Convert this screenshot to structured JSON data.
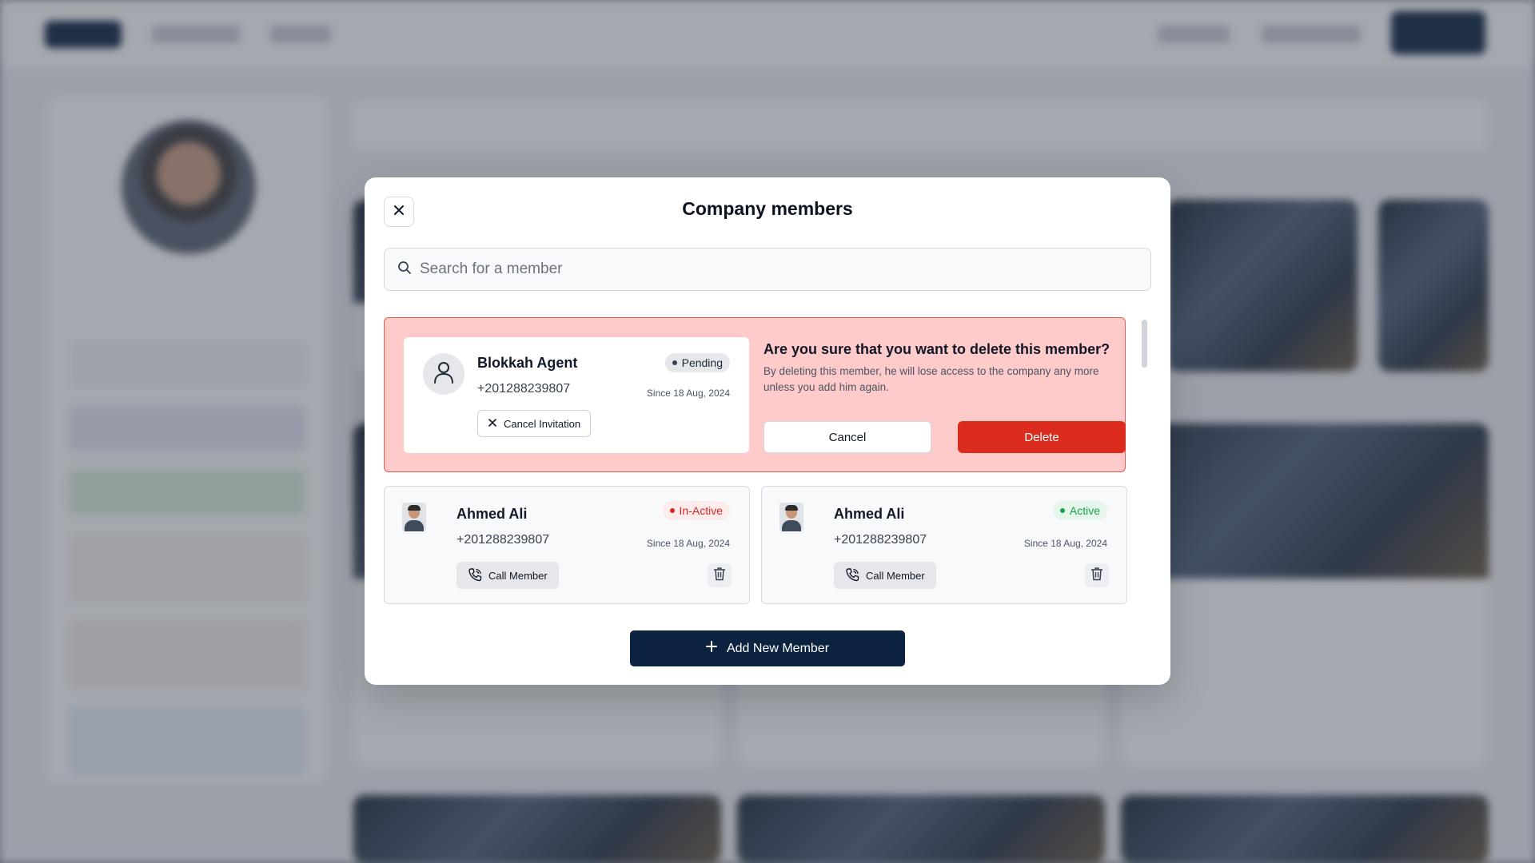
{
  "modal": {
    "title": "Company members",
    "search_placeholder": "Search for a member"
  },
  "pending_member": {
    "name": "Blokkah Agent",
    "phone": "+201288239807",
    "status": "Pending",
    "since": "Since 18 Aug, 2024",
    "cancel_invitation_label": "Cancel Invitation"
  },
  "delete_confirm": {
    "question": "Are you sure that you want to delete this member?",
    "description": "By deleting this member, he will lose access to the company any more unless you add him again.",
    "cancel_label": "Cancel",
    "delete_label": "Delete"
  },
  "members": [
    {
      "name": "Ahmed Ali",
      "phone": "+201288239807",
      "status": "In-Active",
      "since": "Since 18 Aug, 2024",
      "call_label": "Call Member"
    },
    {
      "name": "Ahmed Ali",
      "phone": "+201288239807",
      "status": "Active",
      "since": "Since 18 Aug, 2024",
      "call_label": "Call Member"
    }
  ],
  "add_member_label": "Add New Member",
  "colors": {
    "primary": "#0c2340",
    "danger": "#dc2c20",
    "danger_bg": "#fecaca",
    "active": "#16a34a",
    "inactive": "#dc2626"
  }
}
